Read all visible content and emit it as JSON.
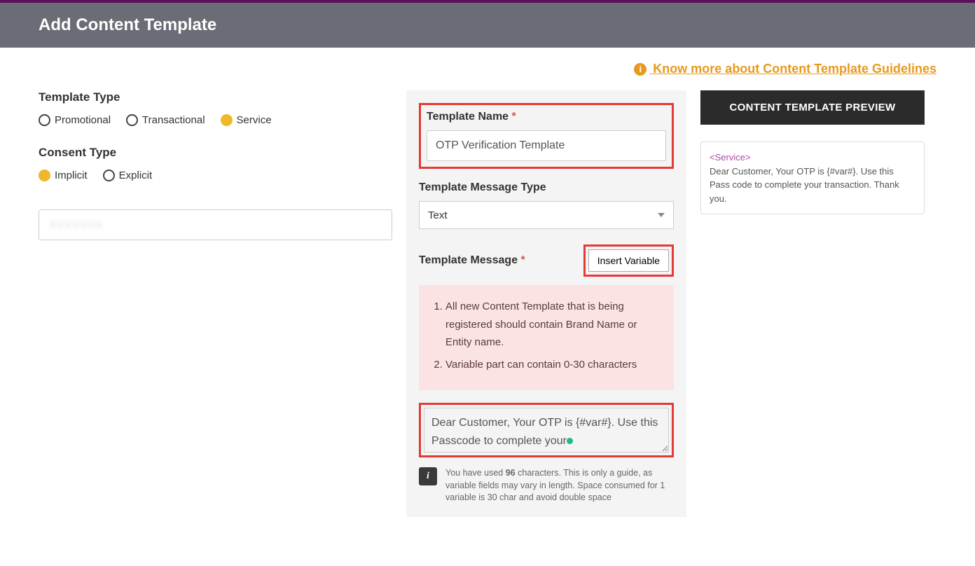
{
  "header": {
    "title": "Add Content Template"
  },
  "guidelines_link": "Know more about Content Template Guidelines",
  "left": {
    "template_type_label": "Template Type",
    "template_types": {
      "promotional": "Promotional",
      "transactional": "Transactional",
      "service": "Service"
    },
    "consent_type_label": "Consent Type",
    "consent_types": {
      "implicit": "Implicit",
      "explicit": "Explicit"
    },
    "blurred_placeholder": "XXXXXXX"
  },
  "mid": {
    "template_name_label": "Template Name",
    "template_name_value": "OTP Verification Template",
    "message_type_label": "Template Message Type",
    "message_type_value": "Text",
    "template_message_label": "Template Message",
    "insert_variable": "Insert Variable",
    "notice1": "All new Content Template that is being registered should contain Brand Name or Entity name.",
    "notice2": "Variable part can contain 0-30 characters",
    "message_value": "Dear Customer, Your OTP is {#var#}. Use this Passcode to complete your",
    "char_info_pre": "You have used ",
    "char_count": "96",
    "char_info_post": " characters. This is only a guide, as variable fields may vary in length. Space consumed for 1 variable is 30 char and avoid double space"
  },
  "right": {
    "preview_header": "CONTENT TEMPLATE PREVIEW",
    "preview_tag": "<Service>",
    "preview_body": "Dear Customer, Your OTP is {#var#}. Use this Pass code to complete your transaction. Thank you."
  }
}
